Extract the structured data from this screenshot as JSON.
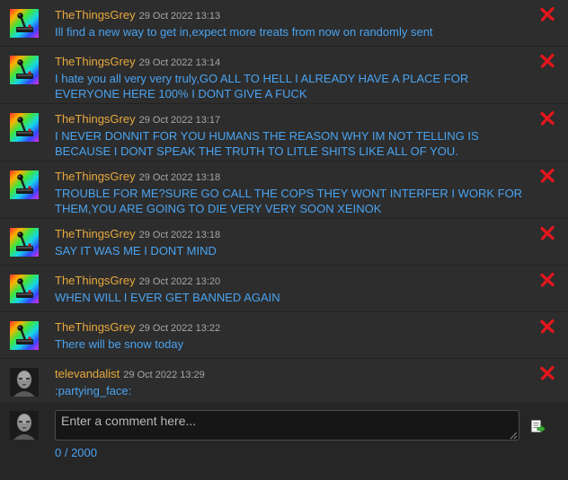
{
  "comments": [
    {
      "author": "TheThingsGrey",
      "timestamp": "29 Oct 2022 13:13",
      "lines": [
        "Ill find a new way to get in,expect more treats from now on randomly sent"
      ],
      "avatar": "rainbow-joystick",
      "delete_icon": "red-x-icon"
    },
    {
      "author": "TheThingsGrey",
      "timestamp": "29 Oct 2022 13:14",
      "lines": [
        "I hate you all very very truly,GO ALL TO HELL I ALREADY HAVE A PLACE FOR",
        "EVERYONE HERE 100% I DONT GIVE A FUCK"
      ],
      "avatar": "rainbow-joystick",
      "delete_icon": "red-x-icon"
    },
    {
      "author": "TheThingsGrey",
      "timestamp": "29 Oct 2022 13:17",
      "lines": [
        "I NEVER DONNIT FOR YOU HUMANS THE REASON WHY IM NOT TELLING IS",
        "BECAUSE I DONT SPEAK THE TRUTH TO LITLE SHITS LIKE ALL OF YOU."
      ],
      "avatar": "rainbow-joystick",
      "delete_icon": "red-x-icon"
    },
    {
      "author": "TheThingsGrey",
      "timestamp": "29 Oct 2022 13:18",
      "lines": [
        "TROUBLE FOR ME?SURE GO CALL THE COPS THEY WONT INTERFER I WORK FOR",
        "THEM,YOU ARE GOING TO DIE VERY VERY SOON XEINOK"
      ],
      "avatar": "rainbow-joystick",
      "delete_icon": "red-x-icon"
    },
    {
      "author": "TheThingsGrey",
      "timestamp": "29 Oct 2022 13:18",
      "lines": [
        "SAY IT WAS ME I DONT MIND"
      ],
      "avatar": "rainbow-joystick",
      "delete_icon": "red-x-icon"
    },
    {
      "author": "TheThingsGrey",
      "timestamp": "29 Oct 2022 13:20",
      "lines": [
        "WHEN WILL I EVER GET BANNED AGAIN"
      ],
      "avatar": "rainbow-joystick",
      "delete_icon": "red-x-icon"
    },
    {
      "author": "TheThingsGrey",
      "timestamp": "29 Oct 2022 13:22",
      "lines": [
        "There will be snow today"
      ],
      "avatar": "rainbow-joystick",
      "delete_icon": "red-x-icon"
    },
    {
      "author": "televandalist",
      "timestamp": "29 Oct 2022 13:29",
      "lines": [
        ":partying_face:"
      ],
      "avatar": "grey-face",
      "delete_icon": "red-x-icon"
    }
  ],
  "compose": {
    "placeholder": "Enter a comment here...",
    "value": "",
    "counter": "0 / 2000",
    "avatar": "grey-face",
    "send_icon": "post-comment-icon"
  },
  "colors": {
    "background": "#2d2d2d",
    "author": "#e8a93e",
    "timestamp": "#a6a6a6",
    "text": "#4aa3f0",
    "delete": "#e3161c"
  }
}
